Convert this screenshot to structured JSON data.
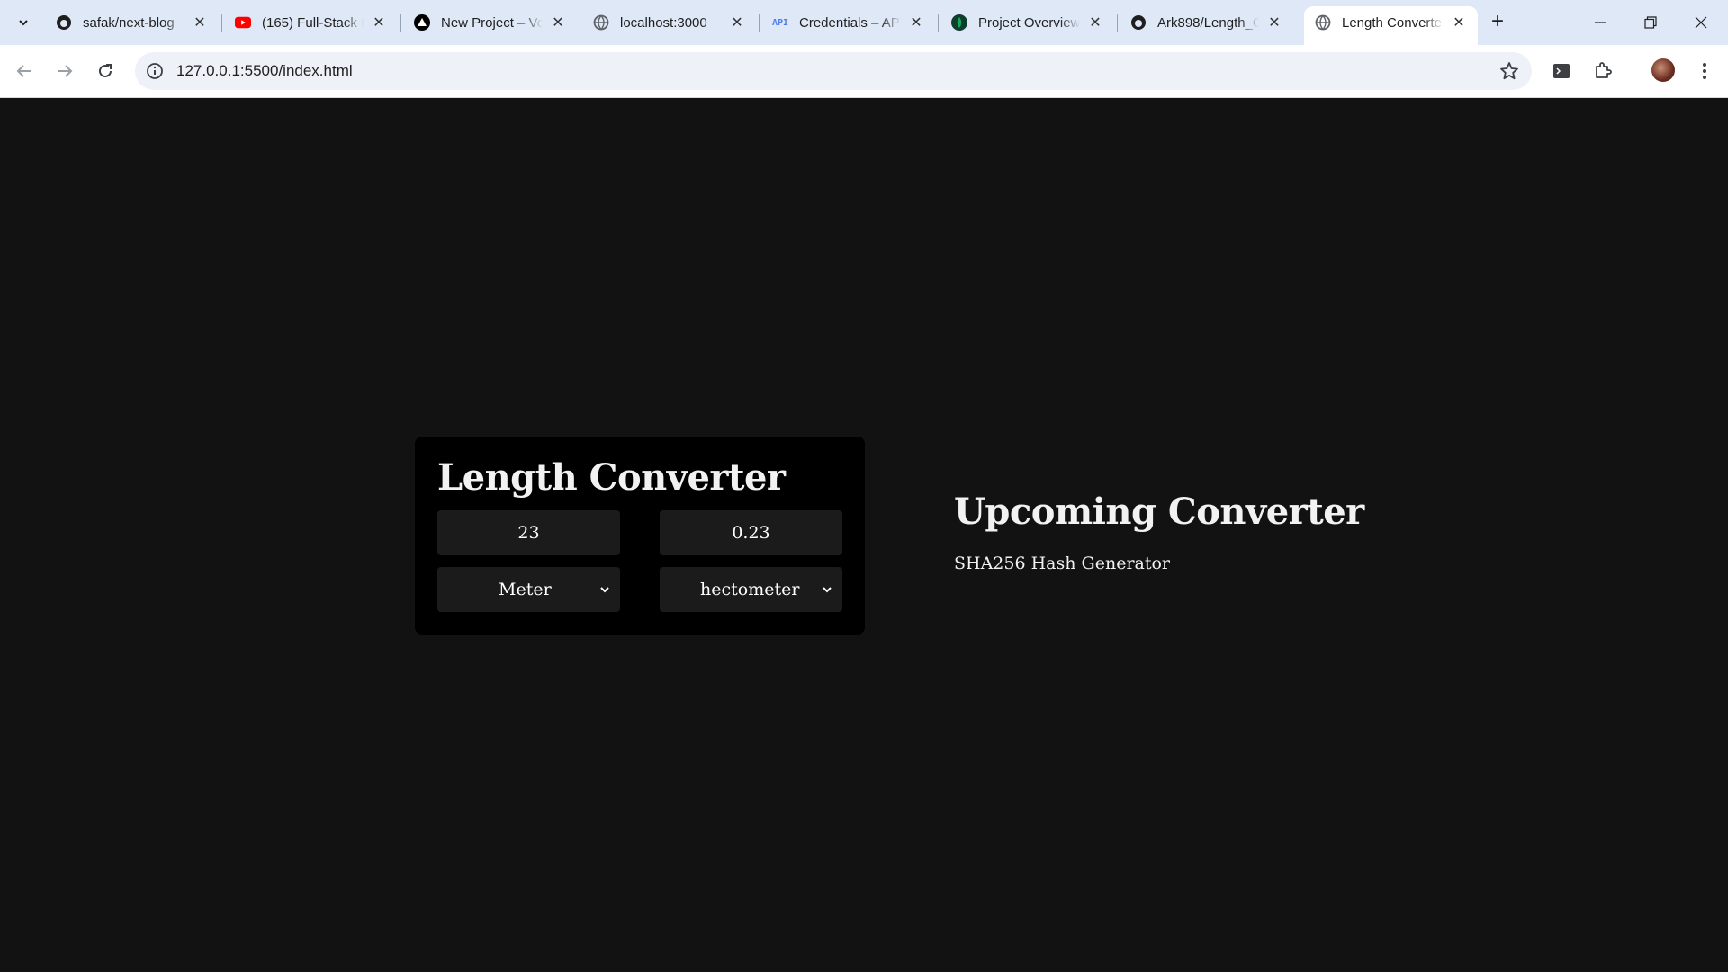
{
  "browser": {
    "tabs": [
      {
        "title": "safak/next-blog",
        "favicon": "github-icon"
      },
      {
        "title": "(165) Full-Stack E",
        "favicon": "youtube-icon"
      },
      {
        "title": "New Project – Ve",
        "favicon": "vercel-icon"
      },
      {
        "title": "localhost:3000",
        "favicon": "globe-icon"
      },
      {
        "title": "Credentials – API",
        "favicon": "api-icon"
      },
      {
        "title": "Project Overview",
        "favicon": "mongodb-icon"
      },
      {
        "title": "Ark898/Length_C",
        "favicon": "github-icon"
      },
      {
        "title": "Length Converte",
        "favicon": "globe-icon",
        "active": true
      }
    ],
    "url": "127.0.0.1:5500/index.html"
  },
  "converter": {
    "title": "Length Converter",
    "input_value": "23",
    "output_value": "0.23",
    "from_unit": "Meter",
    "to_unit": "hectometer"
  },
  "upcoming": {
    "title": "Upcoming Converter",
    "items": [
      "SHA256 Hash Generator"
    ]
  },
  "colors": {
    "page_background": "#121212",
    "card_background": "#000000",
    "field_background": "#1b1b1b",
    "text": "#f2f2f2",
    "tabstrip": "#dfe8f7"
  }
}
